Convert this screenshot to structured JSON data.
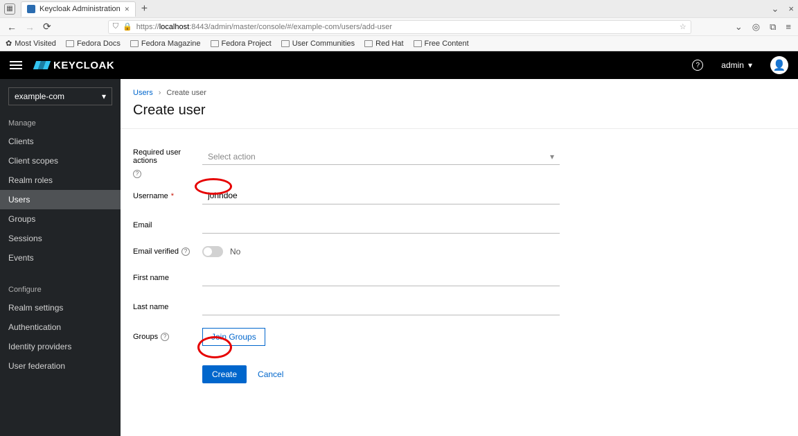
{
  "browser": {
    "tab_title": "Keycloak Administration",
    "url_prefix": "https://",
    "url_host": "localhost",
    "url_rest": ":8443/admin/master/console/#/example-com/users/add-user",
    "bookmarks": [
      "Most Visited",
      "Fedora Docs",
      "Fedora Magazine",
      "Fedora Project",
      "User Communities",
      "Red Hat",
      "Free Content"
    ]
  },
  "header": {
    "logo_text": "KEYCLOAK",
    "user": "admin"
  },
  "sidebar": {
    "realm": "example-com",
    "section_manage": "Manage",
    "section_configure": "Configure",
    "manage_items": [
      "Clients",
      "Client scopes",
      "Realm roles",
      "Users",
      "Groups",
      "Sessions",
      "Events"
    ],
    "configure_items": [
      "Realm settings",
      "Authentication",
      "Identity providers",
      "User federation"
    ],
    "active": "Users"
  },
  "breadcrumb": {
    "root": "Users",
    "current": "Create user"
  },
  "page": {
    "title": "Create user"
  },
  "form": {
    "required_actions": {
      "label": "Required user actions",
      "placeholder": "Select action"
    },
    "username": {
      "label": "Username",
      "value": "johndoe"
    },
    "email": {
      "label": "Email",
      "value": ""
    },
    "email_verified": {
      "label": "Email verified",
      "value_text": "No"
    },
    "first_name": {
      "label": "First name",
      "value": ""
    },
    "last_name": {
      "label": "Last name",
      "value": ""
    },
    "groups": {
      "label": "Groups",
      "button": "Join Groups"
    },
    "submit": "Create",
    "cancel": "Cancel"
  }
}
